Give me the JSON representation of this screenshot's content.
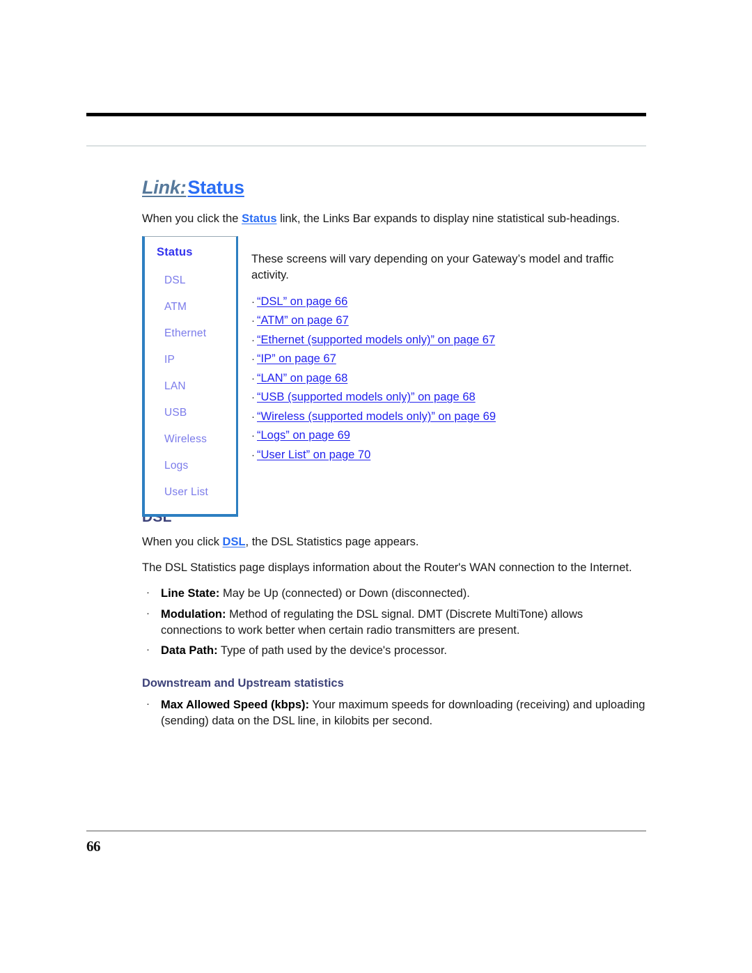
{
  "page": {
    "number": "66"
  },
  "title": {
    "prefix": "Link:",
    "name": "Status"
  },
  "intro": {
    "before_link": "When you click the ",
    "link": "Status",
    "after_link": " link, the Links Bar expands to display nine statistical sub-headings."
  },
  "nav_box": {
    "title": "Status",
    "items": [
      {
        "label": "DSL"
      },
      {
        "label": "ATM"
      },
      {
        "label": "Ethernet"
      },
      {
        "label": "IP"
      },
      {
        "label": "LAN"
      },
      {
        "label": "USB"
      },
      {
        "label": "Wireless"
      },
      {
        "label": "Logs"
      },
      {
        "label": "User List"
      }
    ]
  },
  "nav_side": {
    "note": "These screens will vary depending on your Gateway’s model and traffic activity.",
    "links": [
      {
        "text": "“DSL” on page 66"
      },
      {
        "text": "“ATM” on page 67"
      },
      {
        "text": "“Ethernet (supported models only)” on page 67"
      },
      {
        "text": "“IP” on page 67"
      },
      {
        "text": "“LAN” on page 68"
      },
      {
        "text": "“USB (supported models only)” on page 68"
      },
      {
        "text": "“Wireless (supported models only)” on page 69"
      },
      {
        "text": "“Logs” on page 69"
      },
      {
        "text": "“User List” on page 70"
      }
    ]
  },
  "dsl_section": {
    "heading": "DSL",
    "para1_before": "When you click ",
    "para1_link": "DSL",
    "para1_after": ", the DSL Statistics page appears.",
    "para2": "The DSL Statistics page displays information about the Router's WAN connection to the Internet.",
    "items": [
      {
        "term": "Line State:",
        "desc": " May be Up (connected) or Down (disconnected)."
      },
      {
        "term": "Modulation:",
        "desc": " Method of regulating the DSL signal. DMT (Discrete MultiTone) allows connections to work better when certain radio transmitters are present."
      },
      {
        "term": "Data Path:",
        "desc": " Type of path used by the device's processor."
      }
    ],
    "subheading": "Downstream and Upstream statistics",
    "sub_items": [
      {
        "term": "Max Allowed Speed (kbps):",
        "desc": " Your maximum speeds for downloading (receiving) and uploading (sending) data on the DSL line, in kilobits per second."
      }
    ]
  },
  "colors": {
    "title_prefix": "#57799b",
    "title_name": "#2a6df4",
    "link": "#2222ee",
    "nav_title": "#3333ee",
    "nav_item": "#7b7bea",
    "section_heading": "#3d4279",
    "nav_border": "#2d7fc1",
    "rule_thick": "#000000",
    "rule_thin": "#b9c4c6",
    "rule_footer": "#a8a8a8"
  },
  "bullet_glyph": "·"
}
